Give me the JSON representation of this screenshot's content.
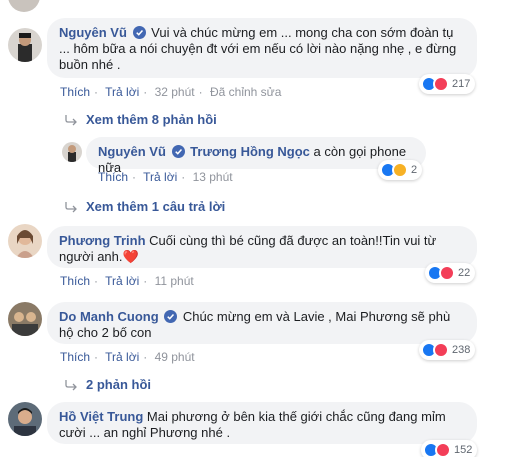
{
  "comments": [
    {
      "name": "Nguyên Vũ",
      "verified": true,
      "text": "Vui và chúc mừng em ... mong cha con sớm đoàn tụ ... hôm bữa a nói chuyện đt với em nếu có lời nào nặng nhẹ , e đừng buồn nhé .",
      "like": "Thích",
      "reply": "Trả lời",
      "time": "32 phút",
      "edited": "Đã chỉnh sửa",
      "reaction_count": "217"
    },
    {
      "name": "Nguyên Vũ",
      "verified": true,
      "mention": "Trương Hồng Ngọc",
      "text": "a còn gọi phone nữa",
      "like": "Thích",
      "reply": "Trả lời",
      "time": "13 phút",
      "reaction_count": "2"
    },
    {
      "name": "Phương Trinh",
      "verified": false,
      "text": "Cuối cùng thì bé cũng đã được an toàn!!Tin vui từ người anh.",
      "emoji": "❤️",
      "like": "Thích",
      "reply": "Trả lời",
      "time": "11 phút",
      "reaction_count": "22"
    },
    {
      "name": "Do Manh Cuong",
      "verified": true,
      "text": "Chúc mừng em và Lavie , Mai Phương sẽ phù hộ cho 2 bố con",
      "like": "Thích",
      "reply": "Trả lời",
      "time": "49 phút",
      "reaction_count": "238"
    },
    {
      "name": "Hồ Việt Trung",
      "verified": false,
      "text": "Mai phương ở bên kia thế giới chắc cũng đang mỉm cười ... an nghỉ Phương nhé .",
      "reaction_count": "152"
    }
  ],
  "replies_links": {
    "first": "Xem thêm 8 phản hồi",
    "second": "Xem thêm 1 câu trả lời",
    "third": "2 phản hồi"
  },
  "colors": {
    "name": "#385898",
    "bubble": "#f2f3f5",
    "like": "#1877f2",
    "love": "#f33e58",
    "sad": "#f7b125"
  }
}
